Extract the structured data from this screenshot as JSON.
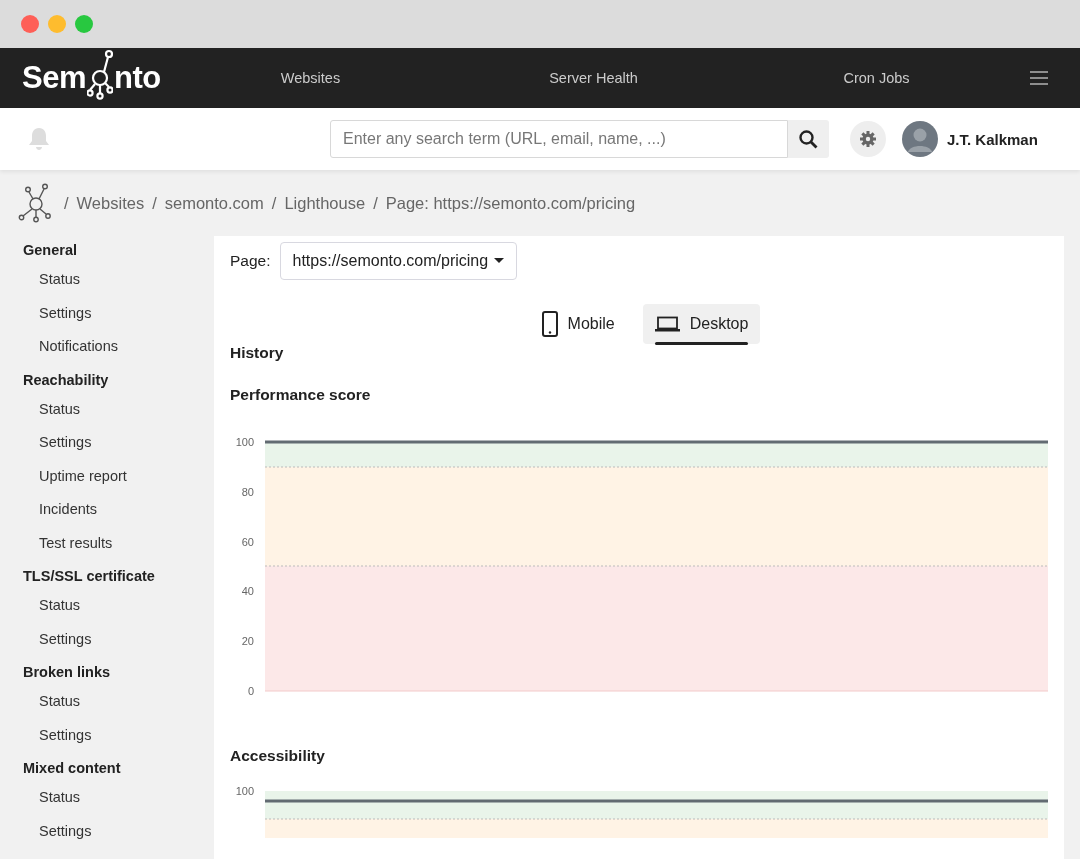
{
  "navbar": {
    "logo_start": "Sem",
    "logo_end": "nto",
    "links": [
      "Websites",
      "Server Health",
      "Cron Jobs"
    ]
  },
  "header": {
    "search": {
      "placeholder": "Enter any search term (URL, email, name, ...)"
    },
    "user_name": "J.T. Kalkman"
  },
  "breadcrumb": [
    {
      "separator": "/",
      "label": "Websites"
    },
    {
      "separator": "/",
      "label": "semonto.com"
    },
    {
      "separator": "/",
      "label": "Lighthouse"
    },
    {
      "separator": "/",
      "label": "Page: https://semonto.com/pricing"
    }
  ],
  "sidebar": {
    "groups": [
      {
        "title": "General",
        "items": [
          "Status",
          "Settings",
          "Notifications"
        ]
      },
      {
        "title": "Reachability",
        "items": [
          "Status",
          "Settings",
          "Uptime report",
          "Incidents",
          "Test results"
        ]
      },
      {
        "title": "TLS/SSL certificate",
        "items": [
          "Status",
          "Settings"
        ]
      },
      {
        "title": "Broken links",
        "items": [
          "Status",
          "Settings"
        ]
      },
      {
        "title": "Mixed content",
        "items": [
          "Status",
          "Settings"
        ]
      }
    ]
  },
  "content": {
    "page_label": "Page:",
    "page_select": "https://semonto.com/pricing",
    "device_tabs": [
      {
        "label": "Mobile",
        "kind": "mobile",
        "selected": false
      },
      {
        "label": "Desktop",
        "kind": "desktop",
        "selected": true
      }
    ],
    "history_heading": "History",
    "performance": {
      "title": "Performance score",
      "y_tick_labels": [
        "100",
        "80",
        "60",
        "40",
        "20",
        "0"
      ]
    },
    "accessibility": {
      "title": "Accessibility",
      "y_tick_label": "100"
    }
  }
}
